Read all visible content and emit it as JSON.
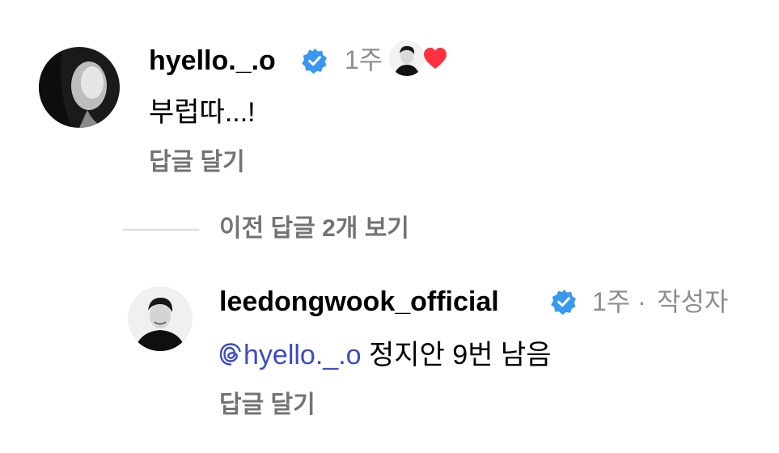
{
  "comment": {
    "username": "hyello._.o",
    "time": "1주",
    "text": "부럽따...!",
    "reply_label": "답글 달기",
    "liked_by_author": true
  },
  "view_replies_label": "이전 답글 2개 보기",
  "reply": {
    "username": "leedongwook_official",
    "time": "1주",
    "separator": "·",
    "author_badge": "작성자",
    "mention": "hyello._.o",
    "mention_icon": "threads-icon",
    "text": " 정지안 9번 남음",
    "reply_label": "답글 달기"
  },
  "colors": {
    "verified": "#3897f0",
    "heart": "#ff3040",
    "mention": "#3b4bc8",
    "muted": "#737373"
  }
}
